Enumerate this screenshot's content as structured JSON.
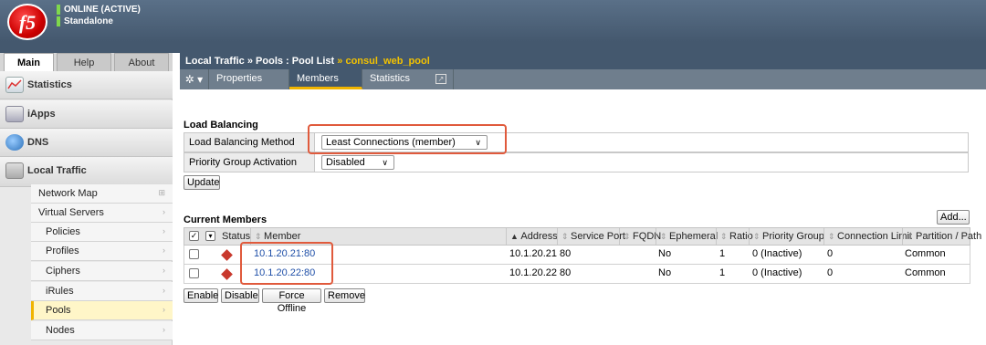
{
  "header": {
    "logo_text": "f5",
    "status_online": "ONLINE (ACTIVE)",
    "status_mode": "Standalone"
  },
  "leftnav": {
    "tabs": [
      "Main",
      "Help",
      "About"
    ],
    "sections": [
      {
        "label": "Statistics",
        "icon": "statistics-icon"
      },
      {
        "label": "iApps",
        "icon": "iapps-icon"
      },
      {
        "label": "DNS",
        "icon": "dns-icon"
      },
      {
        "label": "Local Traffic",
        "icon": "local-traffic-icon"
      }
    ],
    "subitems": [
      "Network Map",
      "Virtual Servers",
      "Policies",
      "Profiles",
      "Ciphers",
      "iRules",
      "Pools",
      "Nodes"
    ]
  },
  "breadcrumb": {
    "part1": "Local Traffic",
    "sep1": "»",
    "part2": "Pools : Pool List",
    "sep2": "»",
    "current": "consul_web_pool"
  },
  "tabs": {
    "properties": "Properties",
    "members": "Members",
    "statistics": "Statistics"
  },
  "load_balancing": {
    "title": "Load Balancing",
    "method_label": "Load Balancing Method",
    "method_value": "Least Connections (member)",
    "priority_label": "Priority Group Activation",
    "priority_value": "Disabled",
    "update_label": "Update"
  },
  "members": {
    "title": "Current Members",
    "add_label": "Add...",
    "columns": [
      "Status",
      "Member",
      "Address",
      "Service Port",
      "FQDN",
      "Ephemeral",
      "Ratio",
      "Priority Group",
      "Connection Limit",
      "Partition / Path"
    ],
    "rows": [
      {
        "member": "10.1.20.21:80",
        "address": "10.1.20.21",
        "port": "80",
        "fqdn": "",
        "ephemeral": "No",
        "ratio": "1",
        "priority": "0 (Inactive)",
        "conn_limit": "0",
        "partition": "Common"
      },
      {
        "member": "10.1.20.22:80",
        "address": "10.1.20.22",
        "port": "80",
        "fqdn": "",
        "ephemeral": "No",
        "ratio": "1",
        "priority": "0 (Inactive)",
        "conn_limit": "0",
        "partition": "Common"
      }
    ],
    "actions": [
      "Enable",
      "Disable",
      "Force Offline",
      "Remove"
    ]
  },
  "colors": {
    "header": "#44586e",
    "accent": "#f0b400",
    "status_ok": "#7fd84c",
    "status_down": "#c8382c",
    "highlight": "#e05a3c"
  }
}
